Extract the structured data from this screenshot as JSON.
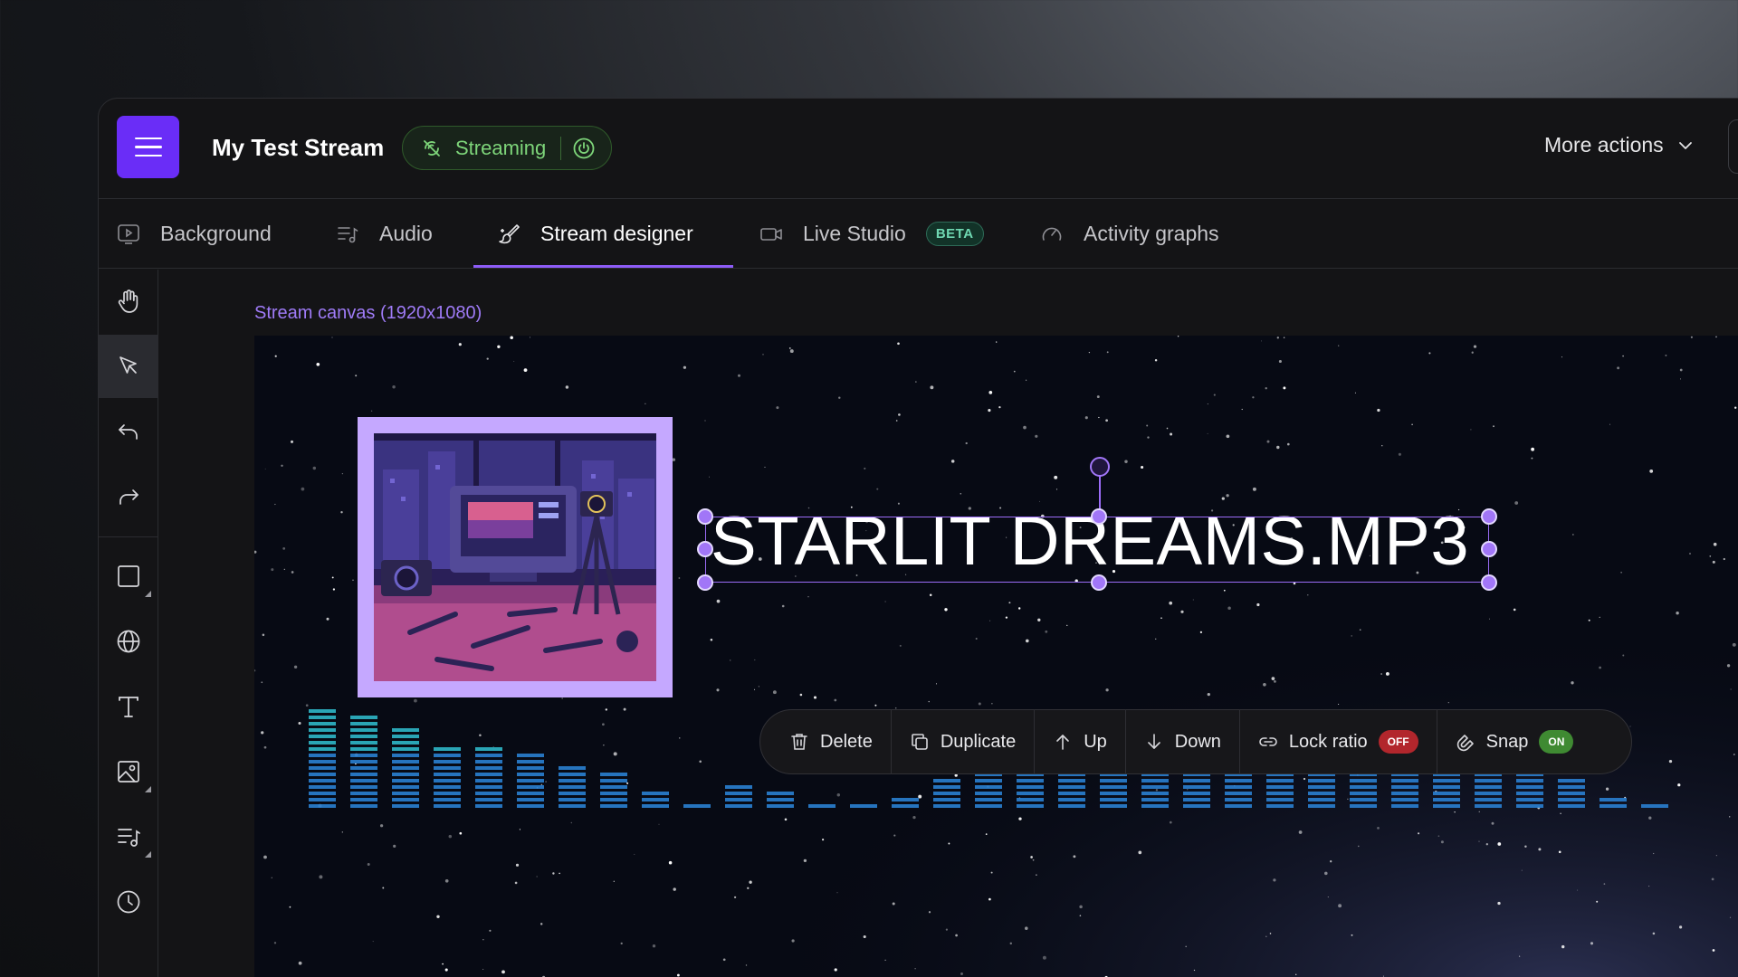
{
  "header": {
    "title": "My Test Stream",
    "status_label": "Streaming",
    "more_actions_label": "More actions"
  },
  "tabs": [
    {
      "label": "Background",
      "icon": "video-play-icon"
    },
    {
      "label": "Audio",
      "icon": "music-list-icon"
    },
    {
      "label": "Stream designer",
      "icon": "brush-icon",
      "active": true
    },
    {
      "label": "Live Studio",
      "icon": "camera-icon",
      "badge": "BETA"
    },
    {
      "label": "Activity graphs",
      "icon": "gauge-icon"
    }
  ],
  "toolbar": {
    "tools": [
      "hand-icon",
      "pointer-icon",
      "undo-icon",
      "redo-icon",
      "rectangle-icon",
      "globe-icon",
      "text-icon",
      "image-icon",
      "audio-list-icon",
      "clock-icon"
    ],
    "active_tool": "pointer-icon"
  },
  "canvas": {
    "label": "Stream canvas (1920x1080)",
    "song_title": "STARLIT DREAMS.MP3"
  },
  "element_actions": {
    "delete_label": "Delete",
    "duplicate_label": "Duplicate",
    "up_label": "Up",
    "down_label": "Down",
    "lock_ratio_label": "Lock ratio",
    "lock_ratio_state": "OFF",
    "snap_label": "Snap",
    "snap_state": "ON"
  },
  "colors": {
    "accent": "#6a2df7",
    "streaming_green": "#7ed67a",
    "selection": "#9b6cf7",
    "off_red": "#b2262c",
    "on_green": "#3f8a32",
    "visualizer_blue": "#2a7fd0"
  }
}
